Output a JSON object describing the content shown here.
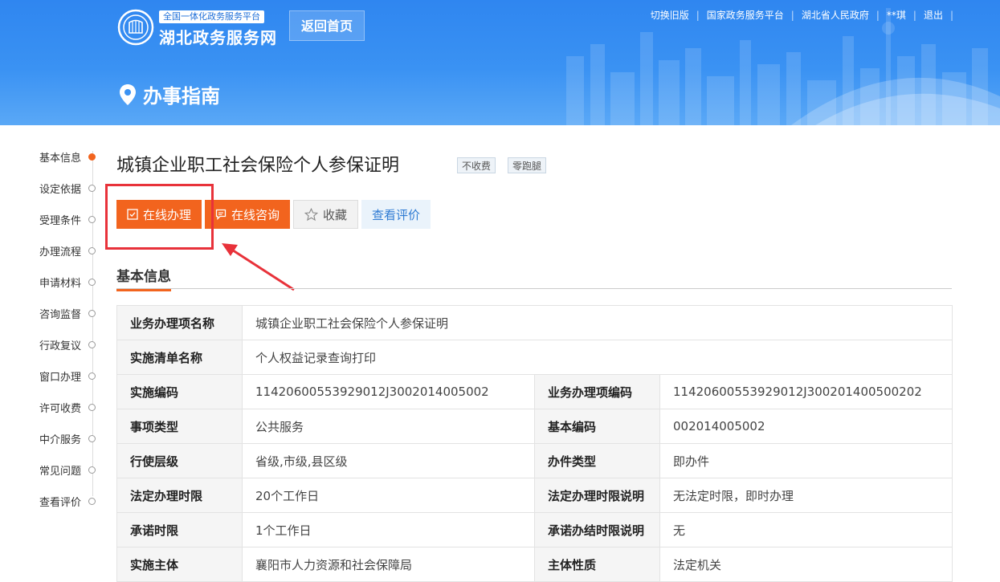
{
  "header": {
    "logo_tag": "全国一体化政务服务平台",
    "logo_title": "湖北政务服务网",
    "home_button": "返回首页",
    "top_links": [
      "切换旧版",
      "国家政务服务平台",
      "湖北省人民政府",
      "**琪",
      "退出"
    ],
    "page_label": "办事指南",
    "colors": {
      "header_blue": "#3a92f3",
      "accent_orange": "#f2641e"
    }
  },
  "sidebar": {
    "items": [
      {
        "label": "基本信息",
        "active": true
      },
      {
        "label": "设定依据",
        "active": false
      },
      {
        "label": "受理条件",
        "active": false
      },
      {
        "label": "办理流程",
        "active": false
      },
      {
        "label": "申请材料",
        "active": false
      },
      {
        "label": "咨询监督",
        "active": false
      },
      {
        "label": "行政复议",
        "active": false
      },
      {
        "label": "窗口办理",
        "active": false
      },
      {
        "label": "许可收费",
        "active": false
      },
      {
        "label": "中介服务",
        "active": false
      },
      {
        "label": "常见问题",
        "active": false
      },
      {
        "label": "查看评价",
        "active": false
      }
    ]
  },
  "main": {
    "title": "城镇企业职工社会保险个人参保证明",
    "badges": [
      "不收费",
      "零跑腿"
    ],
    "actions": {
      "online_handle": "在线办理",
      "online_consult": "在线咨询",
      "favorite": "收藏",
      "view_review": "查看评价"
    },
    "section_title": "基本信息",
    "full_rows": [
      {
        "key": "业务办理项名称",
        "value": "城镇企业职工社会保险个人参保证明"
      },
      {
        "key": "实施清单名称",
        "value": "个人权益记录查询打印"
      }
    ],
    "pair_rows": [
      {
        "k1": "实施编码",
        "v1": "11420600553929012J3002014005002",
        "k2": "业务办理项编码",
        "v2": "11420600553929012J300201400500202"
      },
      {
        "k1": "事项类型",
        "v1": "公共服务",
        "k2": "基本编码",
        "v2": "002014005002"
      },
      {
        "k1": "行使层级",
        "v1": "省级,市级,县区级",
        "k2": "办件类型",
        "v2": "即办件"
      },
      {
        "k1": "法定办理时限",
        "v1": "20个工作日",
        "k2": "法定办理时限说明",
        "v2": "无法定时限，即时办理"
      },
      {
        "k1": "承诺时限",
        "v1": "1个工作日",
        "k2": "承诺办结时限说明",
        "v2": "无"
      },
      {
        "k1": "实施主体",
        "v1": "襄阳市人力资源和社会保障局",
        "k2": "主体性质",
        "v2": "法定机关"
      }
    ]
  }
}
